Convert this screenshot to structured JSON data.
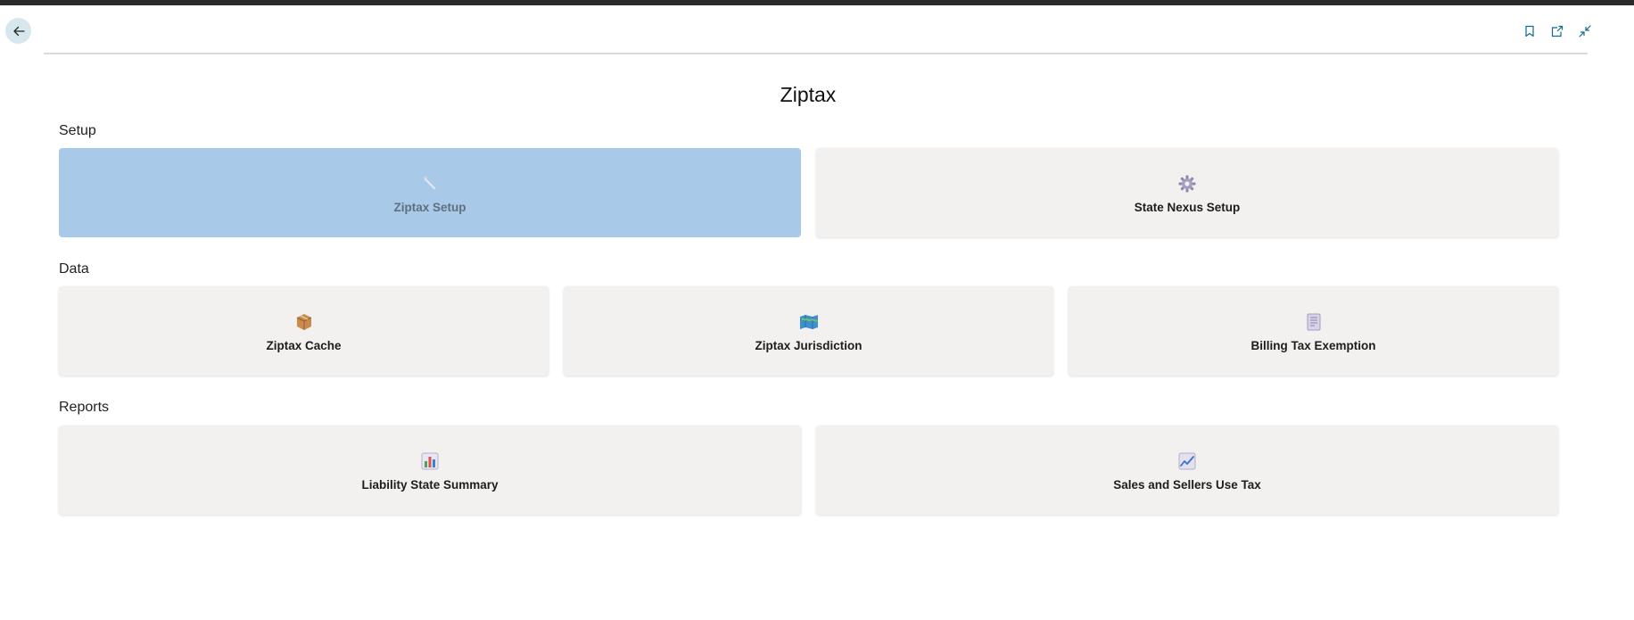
{
  "page": {
    "title": "Ziptax"
  },
  "header": {
    "back_icon": "arrow-left-icon",
    "actions": [
      {
        "name": "bookmark",
        "icon": "bookmark-icon"
      },
      {
        "name": "open-new-window",
        "icon": "open-in-new-icon"
      },
      {
        "name": "collapse",
        "icon": "collapse-icon"
      }
    ]
  },
  "sections": {
    "setup": {
      "title": "Setup",
      "tiles": [
        {
          "label": "Ziptax Setup",
          "icon": "wrench-icon",
          "selected": true
        },
        {
          "label": "State Nexus Setup",
          "icon": "gear-icon",
          "selected": false
        }
      ]
    },
    "data": {
      "title": "Data",
      "tiles": [
        {
          "label": "Ziptax Cache",
          "icon": "package-icon",
          "selected": false
        },
        {
          "label": "Ziptax Jurisdiction",
          "icon": "map-icon",
          "selected": false
        },
        {
          "label": "Billing Tax Exemption",
          "icon": "document-icon",
          "selected": false
        }
      ]
    },
    "reports": {
      "title": "Reports",
      "tiles": [
        {
          "label": "Liability State Summary",
          "icon": "bar-chart-icon",
          "selected": false
        },
        {
          "label": "Sales and Sellers Use Tax",
          "icon": "line-chart-icon",
          "selected": false
        }
      ]
    }
  },
  "colors": {
    "accent": "#0f6c8a",
    "selected_tile": "#a8cae8",
    "tile_background": "#f2f1f0"
  }
}
